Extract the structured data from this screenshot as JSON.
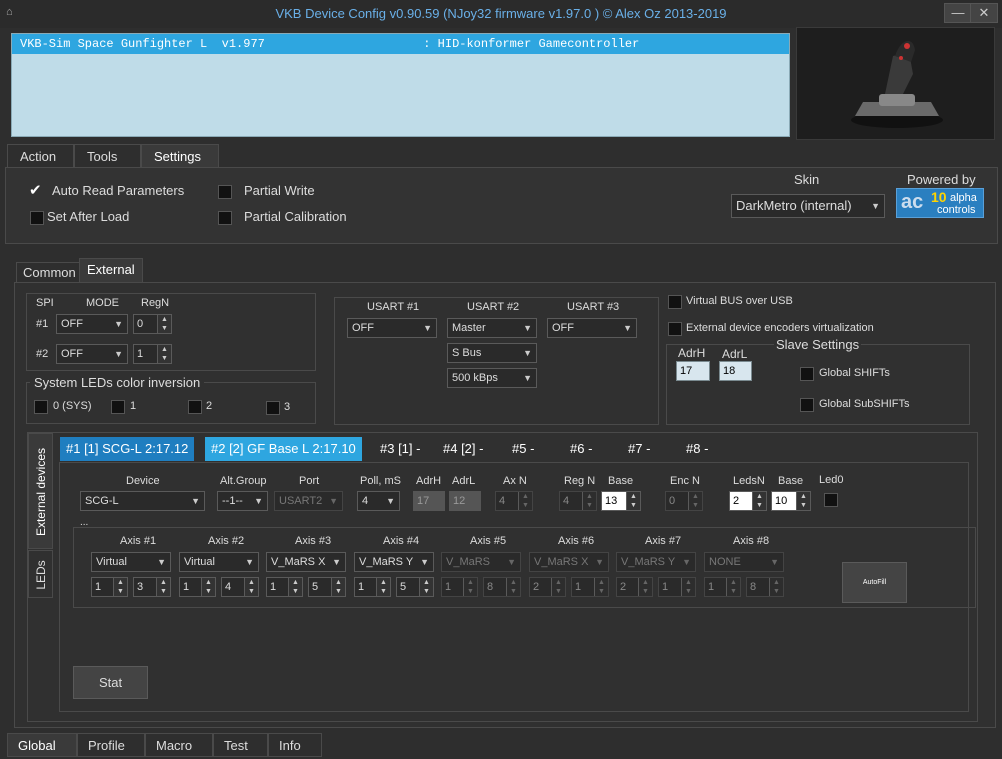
{
  "window": {
    "title": "VKB Device Config v0.90.59 (NJoy32 firmware v1.97.0  ) © Alex Oz 2013-2019",
    "min_label": "—",
    "close_label": "✕"
  },
  "device_list": {
    "rows": [
      "VKB-Sim Space Gunfighter L  v1.977                      : HID-konformer Gamecontroller"
    ]
  },
  "main_tabs": [
    "Action",
    "Tools",
    "Settings"
  ],
  "settings": {
    "auto_read": "Auto Read Parameters",
    "set_after_load": "Set After Load",
    "partial_write": "Partial Write",
    "partial_calibration": "Partial Calibration",
    "skin_label": "Skin",
    "skin_value": "DarkMetro (internal)",
    "powered_by": "Powered by",
    "logo_num": "10",
    "logo_text1": "alpha",
    "logo_text2": "controls"
  },
  "sub_tabs": [
    "Common",
    "External"
  ],
  "spi": {
    "h_spi": "SPI",
    "h_mode": "MODE",
    "h_regn": "RegN",
    "r1": "#1",
    "r2": "#2",
    "mode1": "OFF",
    "mode2": "OFF",
    "reg1": "0",
    "reg2": "1"
  },
  "led_inversion": {
    "title": "System LEDs color inversion",
    "items": [
      "0 (SYS)",
      "1",
      "2",
      "3"
    ]
  },
  "usart": {
    "h1": "USART #1",
    "h2": "USART #2",
    "h3": "USART #3",
    "u1": "OFF",
    "u2": "Master",
    "u3": "OFF",
    "bus": "S Bus",
    "baud": "500 kBps"
  },
  "virtual": {
    "bus_usb": "Virtual BUS over USB",
    "ext_enc": "External device encoders virtualization"
  },
  "slave": {
    "title": "Slave Settings",
    "adrh_label": "AdrH",
    "adrl_label": "AdrL",
    "adrh": "17",
    "adrl": "18",
    "global_shifts": "Global SHIFTs",
    "global_subshifts": "Global SubSHIFTs"
  },
  "side_tabs": [
    "External devices",
    "LEDs"
  ],
  "device_tabs": [
    "#1 [1] SCG-L 2:17.12",
    "#2 [2] GF Base L 2:17.10",
    "#3 [1] -",
    "#4 [2] -",
    "#5 -",
    "#6 -",
    "#7 -",
    "#8 -"
  ],
  "device_params": {
    "h_device": "Device",
    "h_altgroup": "Alt.Group",
    "h_port": "Port",
    "h_poll": "Poll, mS",
    "h_adrh": "AdrH",
    "h_adrl": "AdrL",
    "h_axn": "Ax N",
    "h_regn": "Reg N",
    "h_base": "Base",
    "h_encn": "Enc N",
    "h_ledsn": "LedsN",
    "h_base2": "Base",
    "h_led0": "Led0",
    "device": "SCG-L",
    "altgroup": "--1--",
    "port": "USART2",
    "poll": "4",
    "adrh": "17",
    "adrl": "12",
    "axn": "4",
    "regn": "4",
    "base": "13",
    "encn": "0",
    "ledsn": "2",
    "base2": "10",
    "ellipsis": "..."
  },
  "axes": [
    {
      "h": "Axis #1",
      "sel": "Virtual",
      "a": "1",
      "b": "3",
      "dis": false
    },
    {
      "h": "Axis #2",
      "sel": "Virtual",
      "a": "1",
      "b": "4",
      "dis": false
    },
    {
      "h": "Axis #3",
      "sel": "V_MaRS X",
      "a": "1",
      "b": "5",
      "dis": false
    },
    {
      "h": "Axis #4",
      "sel": "V_MaRS Y",
      "a": "1",
      "b": "5",
      "dis": false
    },
    {
      "h": "Axis #5",
      "sel": "V_MaRS",
      "a": "1",
      "b": "8",
      "dis": true
    },
    {
      "h": "Axis #6",
      "sel": "V_MaRS X",
      "a": "2",
      "b": "1",
      "dis": true
    },
    {
      "h": "Axis #7",
      "sel": "V_MaRS Y",
      "a": "2",
      "b": "1",
      "dis": true
    },
    {
      "h": "Axis #8",
      "sel": "NONE",
      "a": "1",
      "b": "8",
      "dis": true
    }
  ],
  "autofill": "AutoFill",
  "stat": "Stat",
  "bottom_tabs": [
    "Global",
    "Profile",
    "Macro",
    "Test",
    "Info"
  ]
}
